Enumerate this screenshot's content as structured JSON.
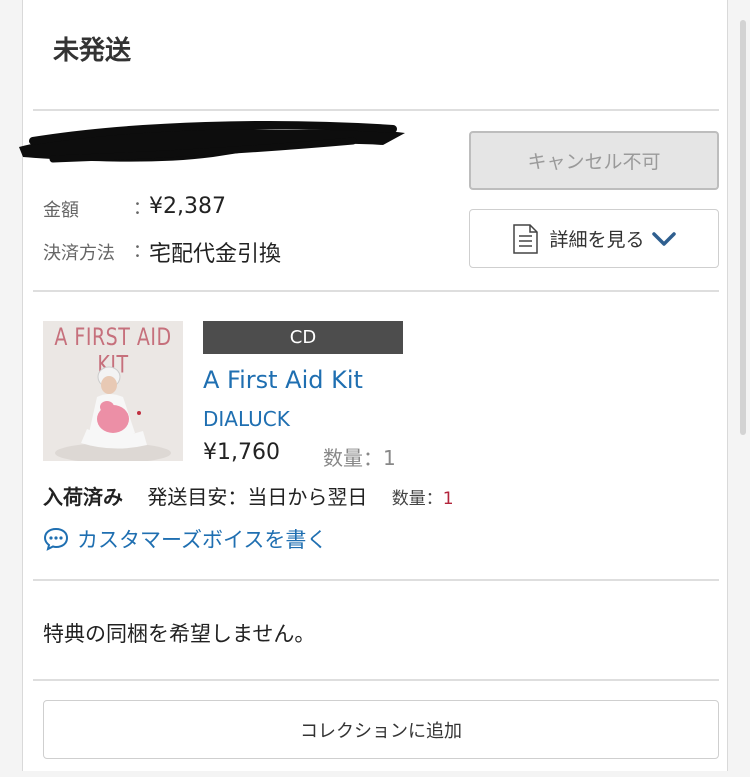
{
  "section": {
    "title": "未発送"
  },
  "order": {
    "amount_label": "金額",
    "amount_sep": "：",
    "amount_value": "¥2,387",
    "payment_label": "決済方法",
    "payment_sep": "：",
    "payment_value": "宅配代金引換",
    "cancel_button": "キャンセル不可",
    "detail_button": "詳細を見る"
  },
  "product": {
    "thumbnail_text": "A FIRST AID KIT",
    "format_tag": "CD",
    "title": "A First Aid Kit",
    "artist": "DIALUCK",
    "price": "¥1,760",
    "qty": "数量：1",
    "stock_status": "入荷済み",
    "ship_estimate": "発送目安：当日から翌日",
    "stock_qty_label": "数量：",
    "stock_qty_value": "1",
    "review_link": "カスタマーズボイスを書く"
  },
  "bonus_note": "特典の同梱を希望しません。",
  "collection_button": "コレクションに追加",
  "colors": {
    "link": "#1f6fb1",
    "qty_accent": "#b3243b",
    "tag_bg": "#4d4d4d"
  },
  "icons": [
    "document-icon",
    "chevron-down-icon",
    "speech-bubble-icon"
  ]
}
